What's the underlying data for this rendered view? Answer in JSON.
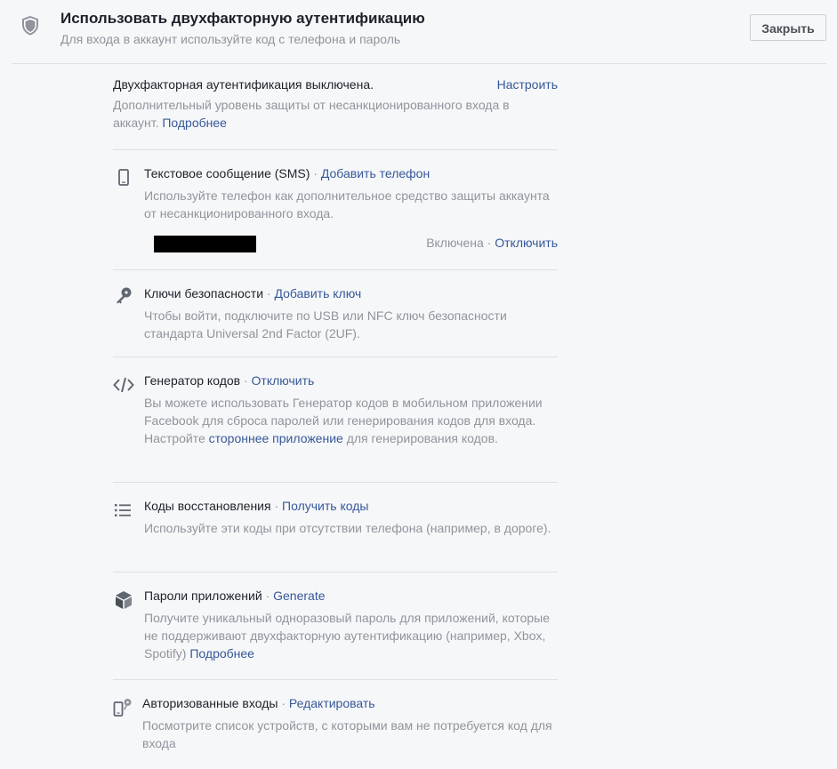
{
  "header": {
    "title": "Использовать двухфакторную аутентификацию",
    "subtitle": "Для входа в аккаунт используйте код с телефона и пароль",
    "close_label": "Закрыть"
  },
  "status": {
    "title": "Двухфакторная аутентификация выключена.",
    "setup_label": "Настроить",
    "desc_text": "Дополнительный уровень защиты от несанкционированного входа в аккаунт. ",
    "learn_more": "Подробнее"
  },
  "sms": {
    "title": "Текстовое сообщение (SMS)",
    "action": "Добавить телефон",
    "desc": "Используйте телефон как дополнительное средство защиты аккаунта от несанкционированного входа.",
    "state": "Включена",
    "disable": "Отключить"
  },
  "keys": {
    "title": "Ключи безопасности",
    "action": "Добавить ключ",
    "desc": "Чтобы войти, подключите по USB или NFC ключ безопасности стандарта Universal 2nd Factor (2UF)."
  },
  "generator": {
    "title": "Генератор кодов",
    "action": "Отключить",
    "desc_pre": "Вы можете использовать Генератор кодов в мобильном приложении Facebook для сброса паролей или генерирования кодов для входа. Настройте ",
    "desc_link": "стороннее приложение",
    "desc_post": " для генерирования кодов."
  },
  "recovery": {
    "title": "Коды восстановления",
    "action": "Получить коды",
    "desc": "Используйте эти коды при отсутствии телефона (например, в дороге)."
  },
  "app_passwords": {
    "title": "Пароли приложений",
    "action": "Generate",
    "desc_text": "Получите уникальный одноразовый пароль для приложений, которые не поддерживают двухфакторную аутентификацию (например, Xbox, Spotify) ",
    "learn_more": "Подробнее"
  },
  "authorized": {
    "title": "Авторизованные входы",
    "action": "Редактировать",
    "desc": "Посмотрите список устройств, с которыми вам не потребуется код для входа"
  },
  "separator": "·",
  "icons": {
    "header": "shield-icon",
    "sms": "mobile-phone-icon",
    "keys": "security-key-icon",
    "generator": "code-icon",
    "recovery": "list-icon",
    "app_passwords": "cube-icon",
    "authorized": "authorized-device-icon"
  },
  "colors": {
    "link": "#365899",
    "muted": "#90949c",
    "text": "#1d2129",
    "background": "#f6f7f9",
    "divider": "#dddfe2"
  }
}
